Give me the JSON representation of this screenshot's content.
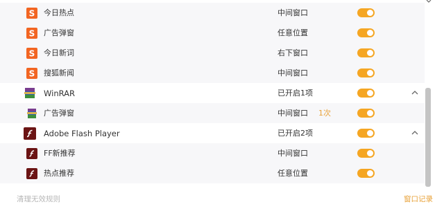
{
  "rules": [
    {
      "name": "今日热点",
      "position": "中间窗口",
      "icon": "sohu-icon",
      "enabled": true
    },
    {
      "name": "广告弹窗",
      "position": "任意位置",
      "icon": "sohu-icon",
      "enabled": true
    },
    {
      "name": "今日新词",
      "position": "右下窗口",
      "icon": "sohu-icon",
      "enabled": true
    },
    {
      "name": "搜狐新闻",
      "position": "中间窗口",
      "icon": "sohu-icon",
      "enabled": true
    }
  ],
  "groups": [
    {
      "name": "WinRAR",
      "status": "已开启1项",
      "icon": "winrar-icon",
      "enabled": true,
      "expanded": true,
      "items": [
        {
          "name": "广告弹窗",
          "position": "中间窗口",
          "count": "1次",
          "icon": "winrar-icon",
          "enabled": true
        }
      ]
    },
    {
      "name": "Adobe Flash Player",
      "status": "已开启2项",
      "icon": "flash-icon",
      "enabled": true,
      "expanded": true,
      "items": [
        {
          "name": "FF新推荐",
          "position": "中间窗口",
          "icon": "flash-icon",
          "enabled": true
        },
        {
          "name": "热点推荐",
          "position": "任意位置",
          "icon": "flash-icon",
          "enabled": true
        }
      ]
    }
  ],
  "footer": {
    "clear_label": "清理无效规则",
    "log_label": "窗口记录"
  },
  "colors": {
    "accent": "#f5a623",
    "sohu": "#f26522",
    "flash": "#6b1414",
    "row_bg": "#f7f7f9"
  }
}
